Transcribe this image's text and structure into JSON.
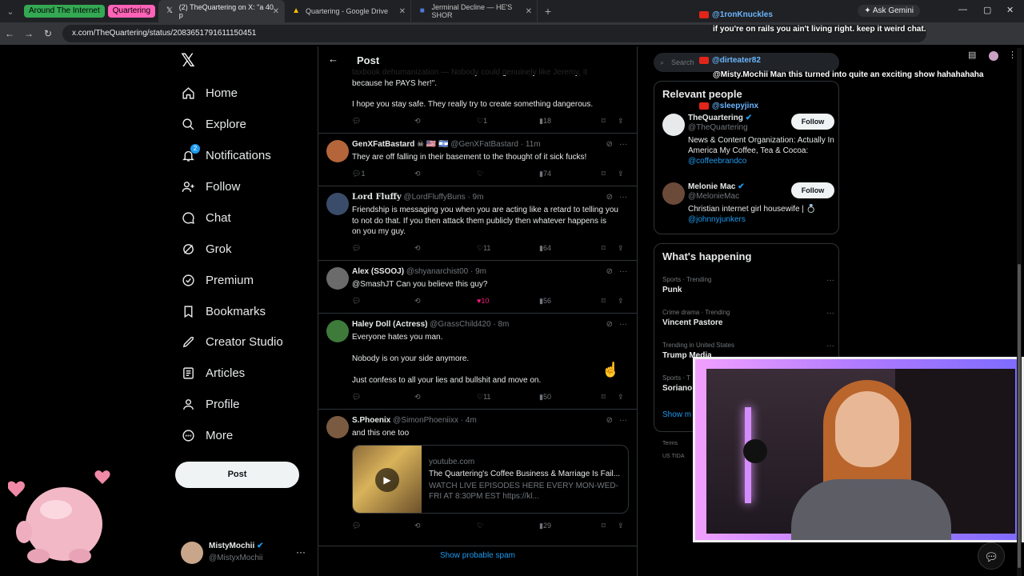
{
  "browser": {
    "tab_groups": [
      {
        "label": "Around The Internet",
        "color": "#34a853"
      },
      {
        "label": "Quartering",
        "color": "#ff63b8"
      }
    ],
    "tabs": [
      {
        "label": "(2) TheQuartering on X: \"a 40 p",
        "icon": "x-logo-icon",
        "active": true
      },
      {
        "label": "Quartering - Google Drive",
        "icon": "google-drive-icon",
        "active": false
      },
      {
        "label": "Jerminal Decline — HE'S SHOR",
        "icon": "bookmark-icon",
        "active": false
      }
    ],
    "gemini_label": "Ask Gemini",
    "url": "x.com/TheQuartering/status/2083651791611150451"
  },
  "nav": {
    "items": [
      {
        "label": "Home",
        "icon": "home-icon"
      },
      {
        "label": "Explore",
        "icon": "search-icon"
      },
      {
        "label": "Notifications",
        "icon": "bell-icon",
        "badge": "2"
      },
      {
        "label": "Follow",
        "icon": "add-user-icon"
      },
      {
        "label": "Chat",
        "icon": "chat-icon"
      },
      {
        "label": "Grok",
        "icon": "grok-icon"
      },
      {
        "label": "Premium",
        "icon": "premium-icon"
      },
      {
        "label": "Bookmarks",
        "icon": "bookmark-icon"
      },
      {
        "label": "Creator Studio",
        "icon": "rocket-icon"
      },
      {
        "label": "Articles",
        "icon": "article-icon"
      },
      {
        "label": "Profile",
        "icon": "person-icon"
      },
      {
        "label": "More",
        "icon": "more-circle-icon"
      }
    ],
    "post_button": "Post",
    "user": {
      "name": "MistyMochii",
      "handle": "@MistyxMochii"
    }
  },
  "center": {
    "header_title": "Post",
    "top_partial": {
      "lines": [
        "taxbook dehumanization — Nobody could genuinely like Jeremy, it",
        "because he PAYS her!\"."
      ],
      "text2": "I hope you stay safe. They really try to create something dangerous.",
      "likes": "1",
      "views": "18"
    },
    "posts": [
      {
        "name": "GenXFatBastard",
        "decor": " ☠ 🇺🇸 🇮🇱",
        "handle": "@GenXFatBastard",
        "time": "· 11m",
        "text": [
          "They are off falling in their basement to the thought of it sick fucks!"
        ],
        "replies": "1",
        "likes": "",
        "views": "74",
        "avatar_color": "#b5653a"
      },
      {
        "name": "Lord Fluffy",
        "decor": "",
        "handle": "@LordFluffyBuns",
        "time": "· 9m",
        "text": [
          "Friendship is messaging you when you are acting like a retard to telling you",
          "to not do that. If you then attack them publicly then whatever happens is",
          "on you my guy."
        ],
        "replies": "",
        "likes": "11",
        "views": "64",
        "avatar_color": "#3b4c6b"
      },
      {
        "name": "Alex (SSOOJ)",
        "decor": "",
        "handle": "@shyanarchist00",
        "time": "· 9m",
        "text": [
          "@SmashJT Can you believe this guy?"
        ],
        "replies": "",
        "likes": "10",
        "views": "56",
        "avatar_color": "#6b6b6b"
      },
      {
        "name": "Haley Doll (Actress)",
        "decor": "",
        "handle": "@GrassChild420",
        "time": "· 8m",
        "text": [
          "Everyone hates you man.",
          "",
          "Nobody is on your side anymore.",
          "",
          "Just confess to all your lies and bullshit and move on."
        ],
        "replies": "",
        "likes": "11",
        "views": "50",
        "avatar_color": "#3e7a3a"
      },
      {
        "name": "S.Phoenix",
        "decor": "",
        "handle": "@SimonPhoeniixx",
        "time": "· 4m",
        "text": [
          "and this one too"
        ],
        "replies": "",
        "likes": "",
        "views": "29",
        "avatar_color": "#7a5a40"
      }
    ],
    "link_card": {
      "domain": "youtube.com",
      "title": "The Quartering's Coffee Business & Marriage Is Fail...",
      "desc": "WATCH LIVE EPISODES HERE EVERY MON-WED-FRI AT 8:30PM EST https://kl..."
    },
    "spam_label": "Show probable spam"
  },
  "right": {
    "search_placeholder": "Search",
    "relevant_title": "Relevant people",
    "people": [
      {
        "name": "TheQuartering",
        "handle": "@TheQuartering",
        "bio": "News & Content Organization: Actually In America My Coffee, Tea & Cocoa:",
        "link": "@coffeebrandco",
        "follow": "Follow"
      },
      {
        "name": "Melonie Mac",
        "handle": "@MelonieMac",
        "bio": "Christian internet girl housewife | 💍",
        "link": "@johnnyjunkers",
        "follow": "Follow"
      }
    ],
    "happening_title": "What's happening",
    "trends": [
      {
        "cat": "Sports · Trending",
        "name": "Punk"
      },
      {
        "cat": "Crime drama · Trending",
        "name": "Vincent Pastore"
      },
      {
        "cat": "Trending in United States",
        "name": "Trump Media"
      },
      {
        "cat": "Sports · T",
        "name": "Soriano"
      }
    ],
    "show_more": "Show m",
    "footer": [
      "Terms",
      "US TIDA"
    ]
  },
  "chat": [
    {
      "user": "@1ronKnuckles",
      "text": "if you're on rails you ain't living right. keep it weird chat."
    },
    {
      "user": "@dirteater82",
      "text": "@Misty.Mochii Man this turned into quite an exciting show hahahahaha"
    },
    {
      "user": "@sleepyjinx",
      "text": ""
    }
  ]
}
